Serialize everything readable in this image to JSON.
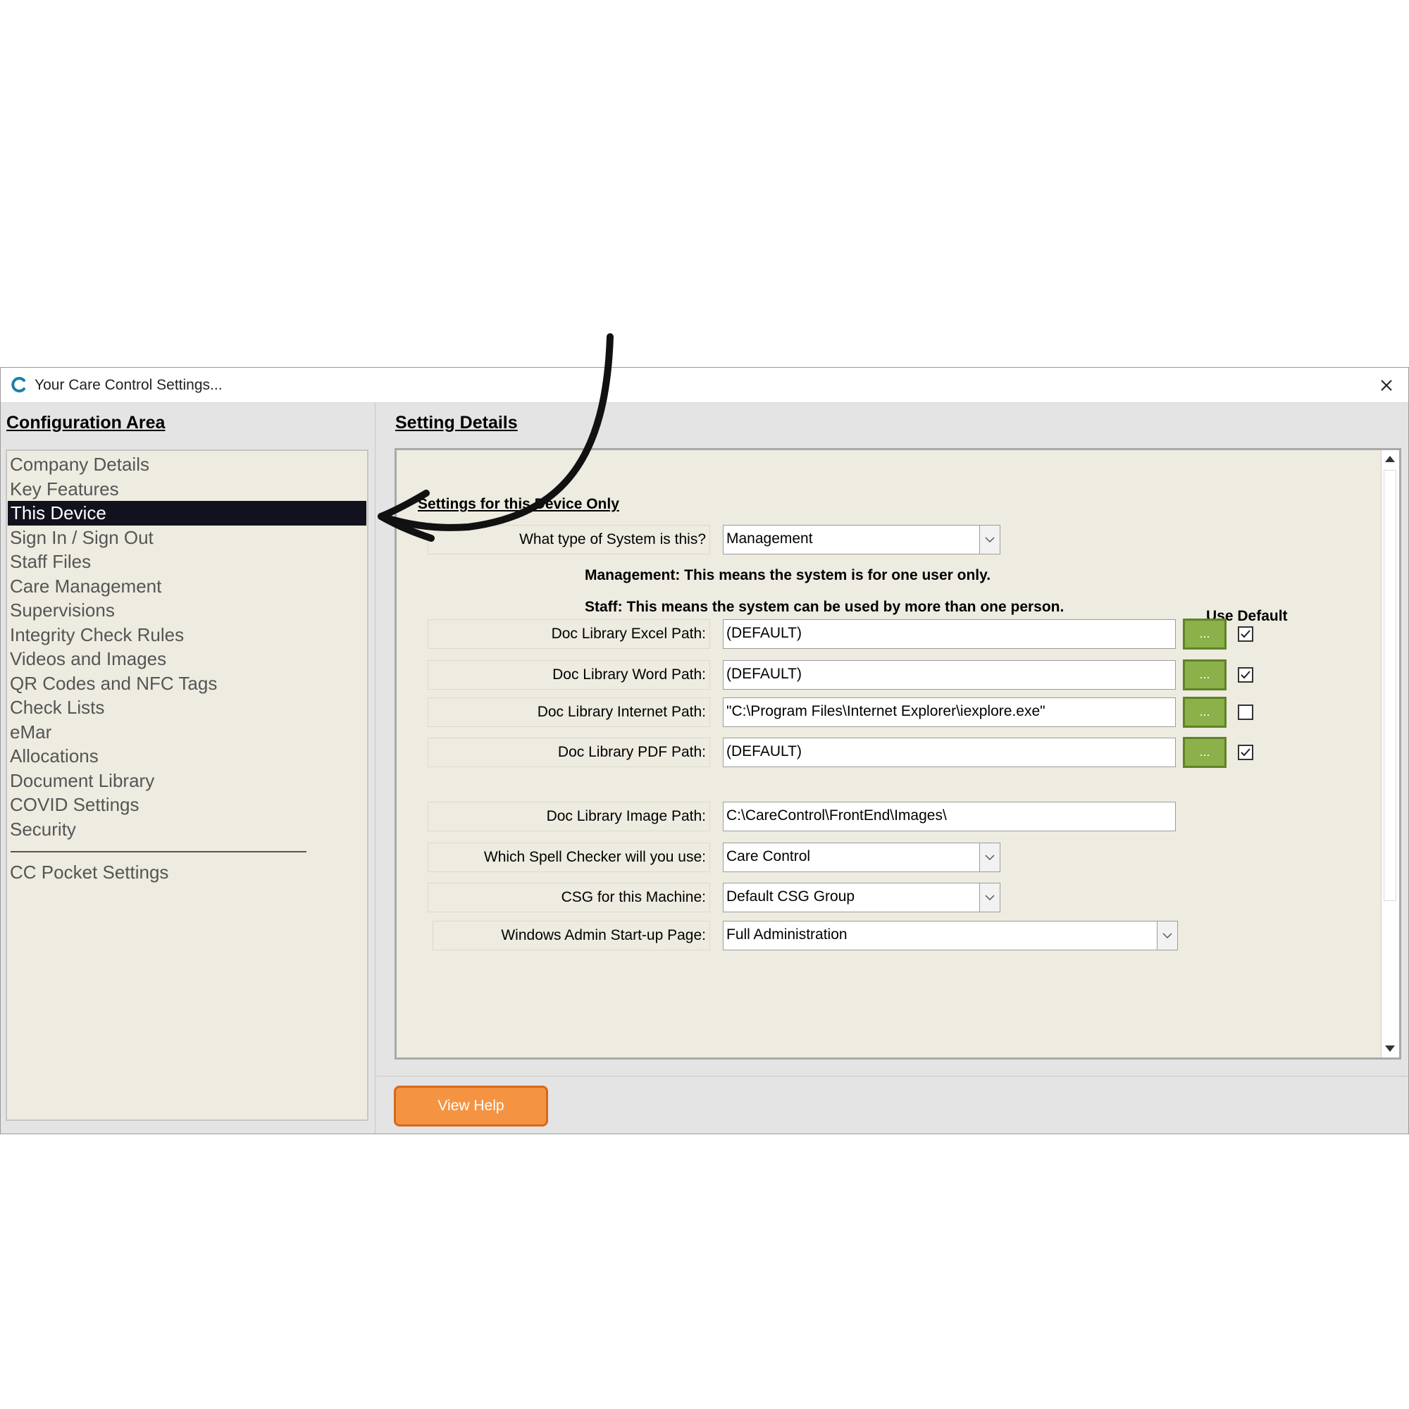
{
  "window": {
    "title": "Your Care Control Settings..."
  },
  "left_panel": {
    "title": "Configuration Area",
    "items": [
      {
        "label": "Company Details",
        "selected": false
      },
      {
        "label": "Key Features",
        "selected": false
      },
      {
        "label": "This Device",
        "selected": true
      },
      {
        "label": "Sign In / Sign Out",
        "selected": false
      },
      {
        "label": "Staff Files",
        "selected": false
      },
      {
        "label": "Care Management",
        "selected": false
      },
      {
        "label": "Supervisions",
        "selected": false
      },
      {
        "label": "Integrity Check Rules",
        "selected": false
      },
      {
        "label": "Videos and Images",
        "selected": false
      },
      {
        "label": "QR Codes and NFC Tags",
        "selected": false
      },
      {
        "label": "Check Lists",
        "selected": false
      },
      {
        "label": "eMar",
        "selected": false
      },
      {
        "label": "Allocations",
        "selected": false
      },
      {
        "label": "Document Library",
        "selected": false
      },
      {
        "label": "COVID Settings",
        "selected": false
      },
      {
        "label": "Security",
        "selected": false
      }
    ],
    "extra_items": [
      {
        "label": "CC Pocket Settings"
      }
    ]
  },
  "right_panel": {
    "title": "Setting Details",
    "section_heading": "Settings for this Device Only",
    "system_type": {
      "label": "What type of System is this?",
      "value": "Management"
    },
    "notes": {
      "management": "Management: This means the system is for one user only.",
      "staff": "Staff: This means the system can be used by more than one person."
    },
    "use_default_heading": "Use Default",
    "paths": [
      {
        "label": "Doc Library Excel Path:",
        "value": "(DEFAULT)",
        "browse": "...",
        "use_default": true
      },
      {
        "label": "Doc Library Word Path:",
        "value": "(DEFAULT)",
        "browse": "...",
        "use_default": true
      },
      {
        "label": "Doc Library Internet Path:",
        "value": "\"C:\\Program Files\\Internet Explorer\\iexplore.exe\"",
        "browse": "...",
        "use_default": false
      },
      {
        "label": "Doc Library PDF Path:",
        "value": "(DEFAULT)",
        "browse": "...",
        "use_default": true
      }
    ],
    "image_path": {
      "label": "Doc Library Image Path:",
      "value": "C:\\CareControl\\FrontEnd\\Images\\"
    },
    "spell_checker": {
      "label": "Which Spell Checker will you use:",
      "value": "Care Control"
    },
    "csg": {
      "label": "CSG for this Machine:",
      "value": "Default CSG Group"
    },
    "startup_page": {
      "label": "Windows Admin Start-up Page:",
      "value": "Full Administration"
    }
  },
  "footer": {
    "help_label": "View Help"
  },
  "colors": {
    "selected_bg": "#12121e",
    "browse_green": "#8cb04a",
    "help_orange": "#f49443",
    "panel_bg": "#eeebe0"
  }
}
